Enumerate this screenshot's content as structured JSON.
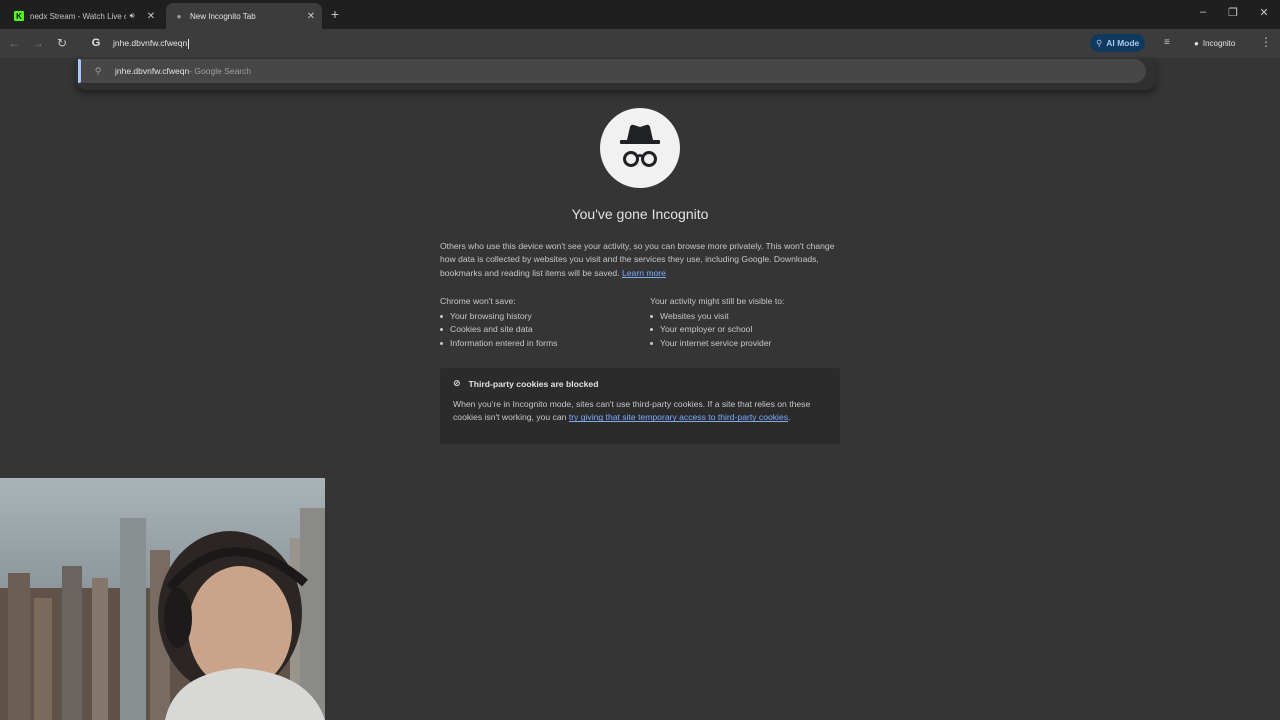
{
  "tabs": [
    {
      "title": "nedx Stream - Watch Live o",
      "audio": true,
      "favicon": "kick-logo",
      "active": false
    },
    {
      "title": "New Incognito Tab",
      "audio": false,
      "favicon": "incognito-icon",
      "active": true
    }
  ],
  "omnibox": {
    "value": "jnhe.dbvnfw.cfweqn"
  },
  "suggestion": {
    "text": "jnhe.dbvnfw.cfweqn",
    "suffix": " - Google Search"
  },
  "toolbar": {
    "ai_mode": "AI Mode",
    "incognito_label": "Incognito"
  },
  "page": {
    "heading": "You've gone Incognito",
    "intro": "Others who use this device won't see your activity, so you can browse more privately. This won't change how data is collected by websites you visit and the services they use, including Google. Downloads, bookmarks and reading list items will be saved.",
    "learn_more": "Learn more",
    "wont_save": {
      "heading": "Chrome won't save:",
      "items": [
        "Your browsing history",
        "Cookies and site data",
        "Information entered in forms"
      ]
    },
    "might_visible": {
      "heading": "Your activity might still be visible to:",
      "items": [
        "Websites you visit",
        "Your employer or school",
        "Your internet service provider"
      ]
    },
    "cookies": {
      "title": "Third-party cookies are blocked",
      "body": "When you're in Incognito mode, sites can't use third-party cookies. If a site that relies on these cookies isn't working, you can ",
      "link": "try giving that site temporary access to third-party cookies",
      "end": "."
    }
  },
  "colors": {
    "background": "#353535",
    "tabstrip": "#1f1f1f",
    "toolbar": "#3c3c3c",
    "link": "#7cacf8",
    "kick_green": "#53fc18"
  }
}
